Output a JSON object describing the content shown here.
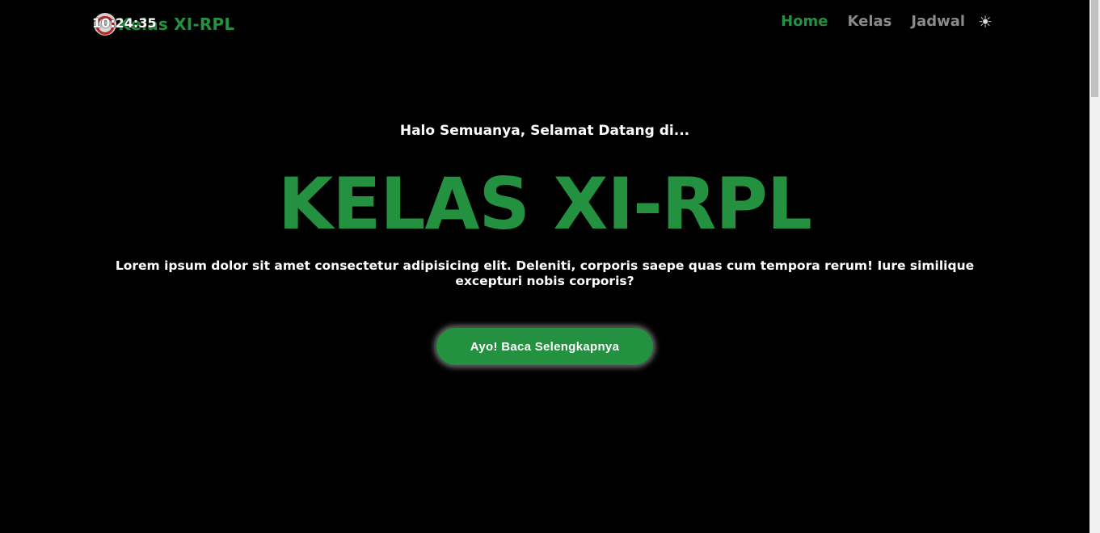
{
  "navbar": {
    "brand_title": "Kelas XI-RPL",
    "clock": "10:24:35",
    "links": [
      {
        "label": "Home",
        "active": true
      },
      {
        "label": "Kelas",
        "active": false
      },
      {
        "label": "Jadwal",
        "active": false
      }
    ],
    "theme_icon": "sun-icon"
  },
  "hero": {
    "greeting": "Halo Semuanya, Selamat Datang di...",
    "title": "KELAS XI-RPL",
    "description": "Lorem ipsum dolor sit amet consectetur adipisicing elit. Deleniti, corporis saepe quas cum tempora rerum! Iure similique excepturi nobis corporis?",
    "cta_label": "Ayo! Baca Selengkapnya"
  },
  "colors": {
    "accent": "#239140",
    "background": "#000000",
    "nav_inactive": "#8a8a8a",
    "text": "#ffffff"
  }
}
